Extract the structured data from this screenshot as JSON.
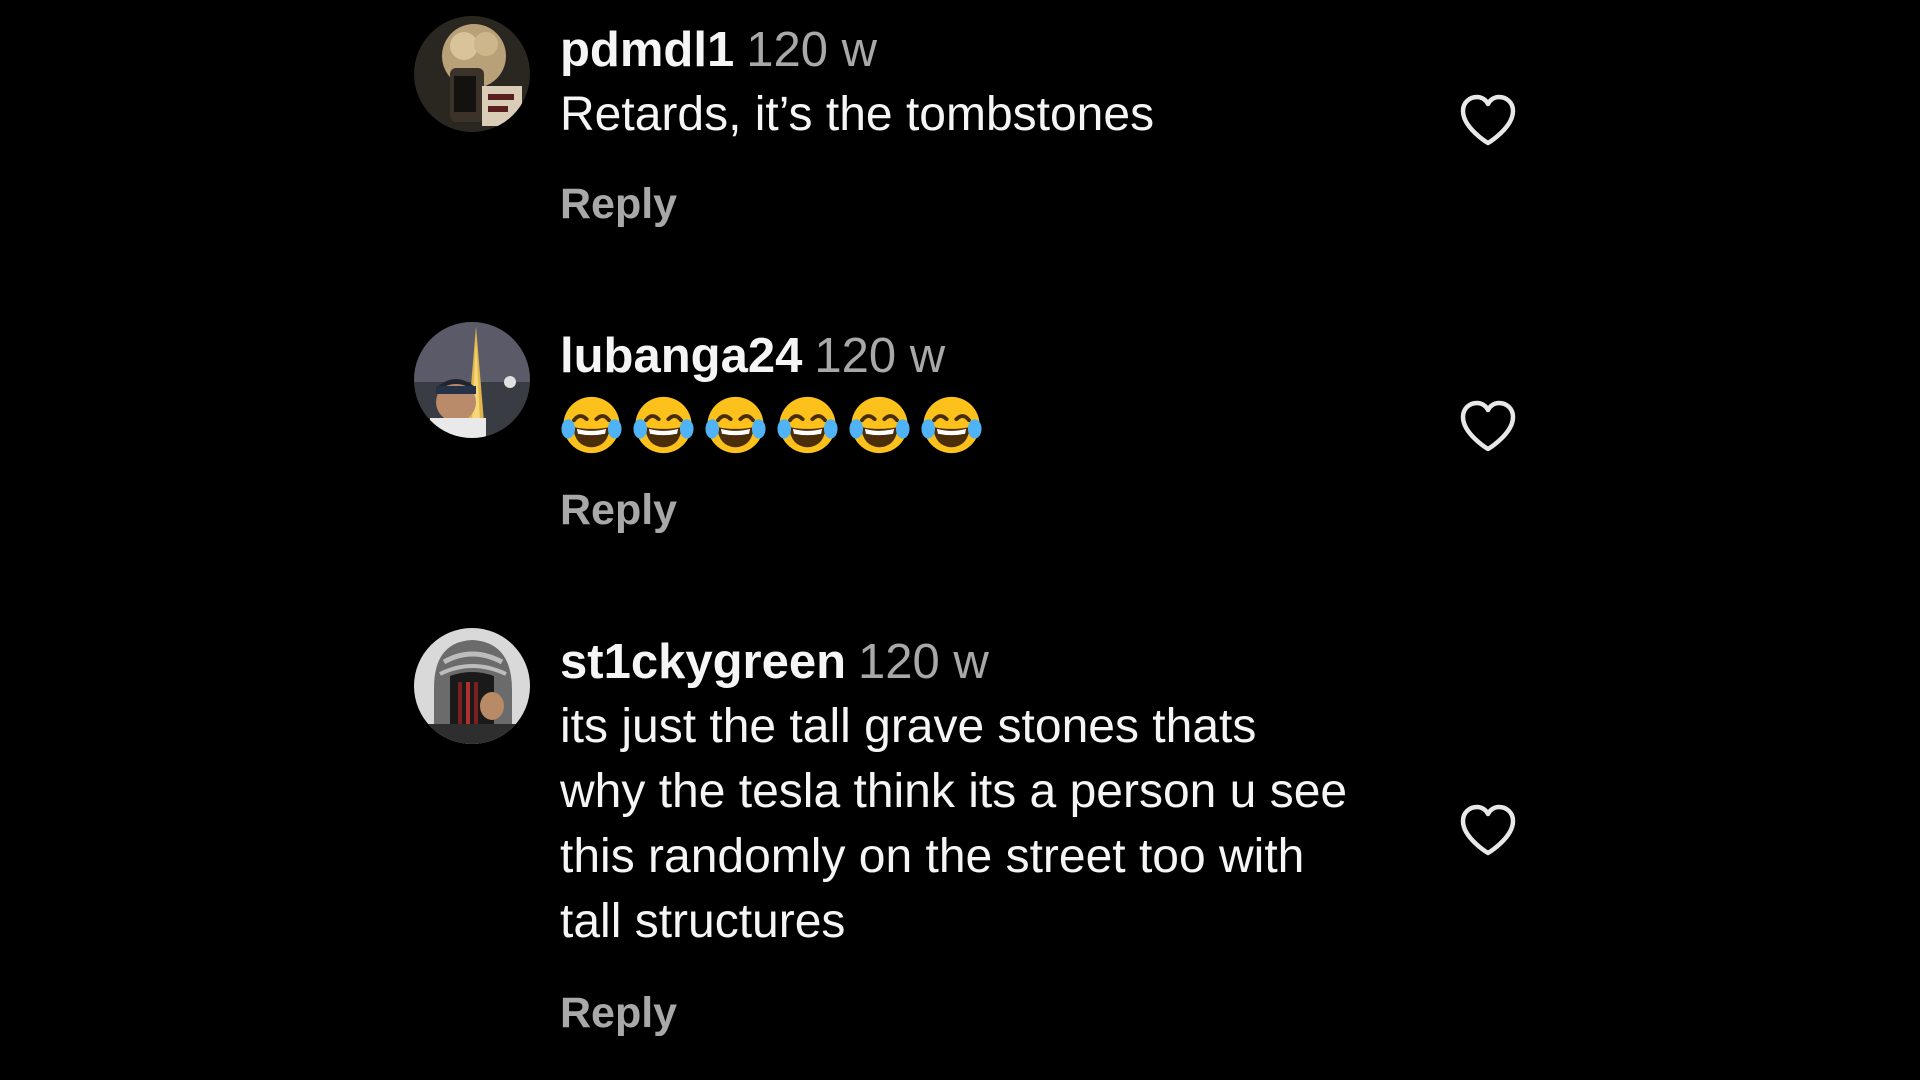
{
  "colors": {
    "background": "#000000",
    "text_primary": "#f5f5f5",
    "text_secondary": "#a8a8a8"
  },
  "comments": [
    {
      "username": "pdmdl1",
      "time": "120 w",
      "text": "Retards, it’s the tombstones",
      "reply_label": "Reply",
      "like_icon": "heart-outline-icon"
    },
    {
      "username": "lubanga24",
      "time": "120 w",
      "emojis": [
        "😂",
        "😂",
        "😂",
        "😂",
        "😂",
        "😂"
      ],
      "reply_label": "Reply",
      "like_icon": "heart-outline-icon"
    },
    {
      "username": "st1ckygreen",
      "time": "120 w",
      "text_lines": [
        "its just the tall grave stones thats",
        "why the tesla think its a person u see",
        "this randomly on the street too with",
        "tall structures"
      ],
      "reply_label": "Reply",
      "like_icon": "heart-outline-icon"
    }
  ]
}
